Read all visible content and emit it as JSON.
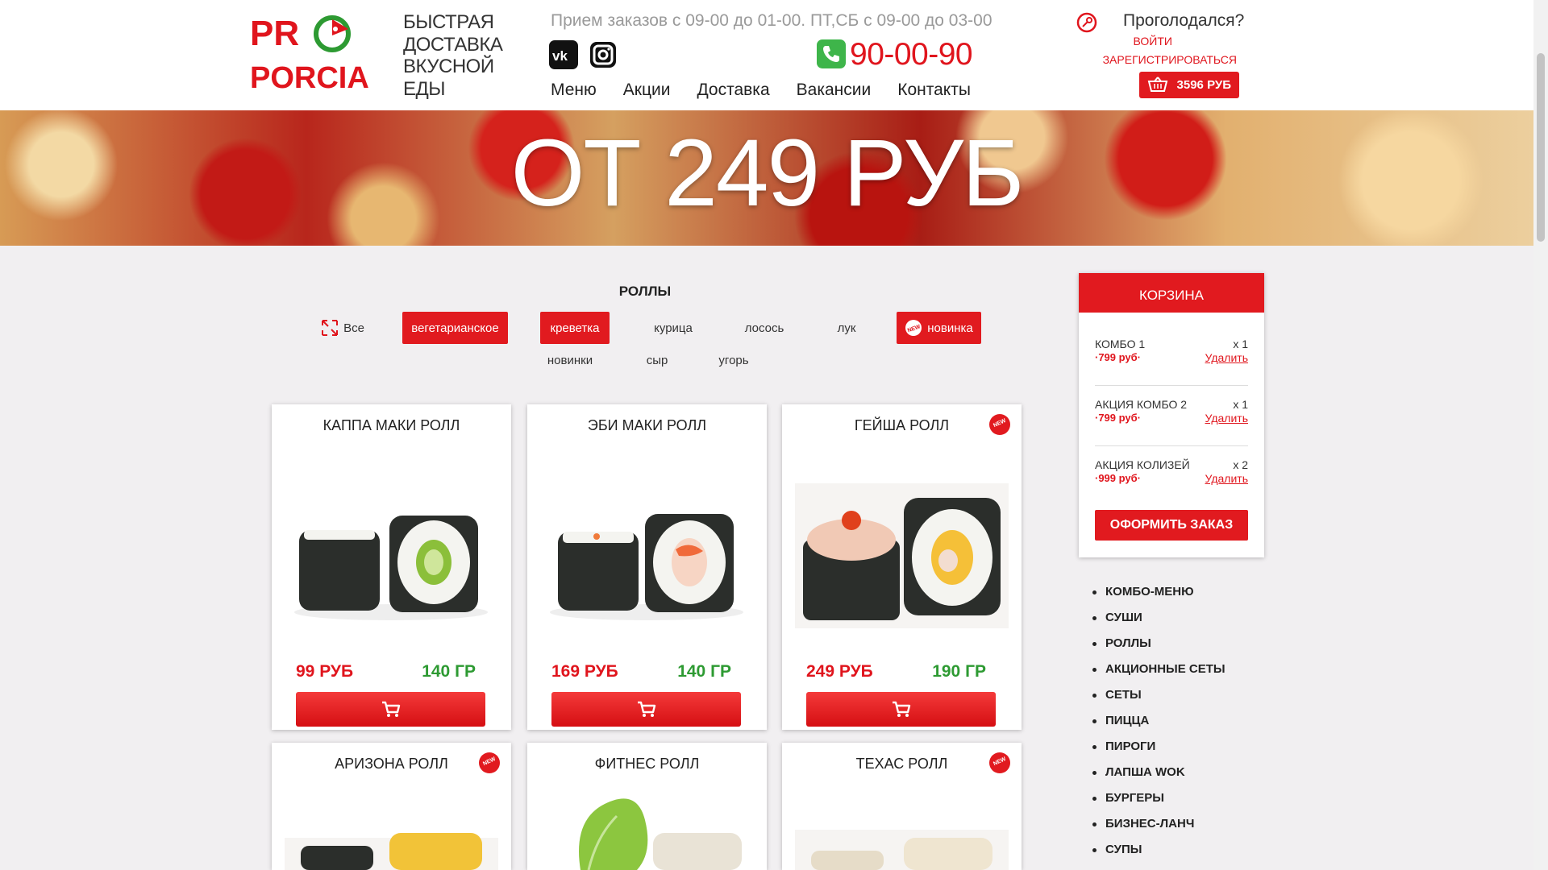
{
  "header": {
    "logo_text": "PRO PORCIA",
    "tagline": [
      "БЫСТРАЯ",
      "ДОСТАВКА",
      "ВКУСНОЙ",
      "ЕДЫ"
    ],
    "hours": "Прием заказов с 09-00 до 01-00. ПТ,СБ с 09-00 до 03-00",
    "phone": "90-00-90",
    "nav": [
      "Меню",
      "Акции",
      "Доставка",
      "Вакансии",
      "Контакты"
    ],
    "hungry": "Проголодался?",
    "login": "ВОЙТИ",
    "register": "ЗАРЕГИСТРИРОВАТЬСЯ",
    "cart_total": "3596 РУБ"
  },
  "banner": {
    "title": "ОТ 249 РУБ"
  },
  "section": {
    "title": "РОЛЛЫ"
  },
  "filters": [
    {
      "label": "Все",
      "icon": "expand-icon"
    },
    {
      "label": "вегетарианское"
    },
    {
      "label": "креветка"
    },
    {
      "label": "курица"
    },
    {
      "label": "лосось"
    },
    {
      "label": "лук"
    },
    {
      "label": "новинка",
      "icon": "new-badge-icon"
    },
    {
      "label": "новинки"
    },
    {
      "label": "сыр"
    },
    {
      "label": "угорь"
    }
  ],
  "products": [
    {
      "name": "КАППА МАКИ РОЛЛ",
      "price": "99 РУБ",
      "weight": "140 ГР",
      "new": false
    },
    {
      "name": "ЭБИ МАКИ РОЛЛ",
      "price": "169 РУБ",
      "weight": "140 ГР",
      "new": false
    },
    {
      "name": "ГЕЙША РОЛЛ",
      "price": "249 РУБ",
      "weight": "190 ГР",
      "new": true
    },
    {
      "name": "АРИЗОНА РОЛЛ",
      "new": true
    },
    {
      "name": "ФИТНЕС РОЛЛ",
      "new": false
    },
    {
      "name": "ТЕХАС РОЛЛ",
      "new": true
    }
  ],
  "side_cart": {
    "title": "КОРЗИНА",
    "items": [
      {
        "name": "КОМБО 1",
        "qty": "x 1",
        "price": "·799 руб·",
        "remove": "Удалить"
      },
      {
        "name": "АКЦИЯ КОМБО 2",
        "qty": "x 1",
        "price": "·799 руб·",
        "remove": "Удалить"
      },
      {
        "name": "АКЦИЯ КОЛИЗЕЙ",
        "qty": "x 2",
        "price": "·999 руб·",
        "remove": "Удалить"
      }
    ],
    "checkout": "ОФОРМИТЬ ЗАКАЗ"
  },
  "categories": [
    "КОМБО-МЕНЮ",
    "СУШИ",
    "РОЛЛЫ",
    "АКЦИОННЫЕ СЕТЫ",
    "СЕТЫ",
    "ПИЦЦА",
    "ПИРОГИ",
    "ЛАПША WOK",
    "БУРГЕРЫ",
    "БИЗНЕС-ЛАНЧ",
    "СУПЫ"
  ],
  "colors": {
    "accent": "#e11a1f",
    "green": "#2d9a32",
    "phone_icon": "#3eb54a"
  }
}
